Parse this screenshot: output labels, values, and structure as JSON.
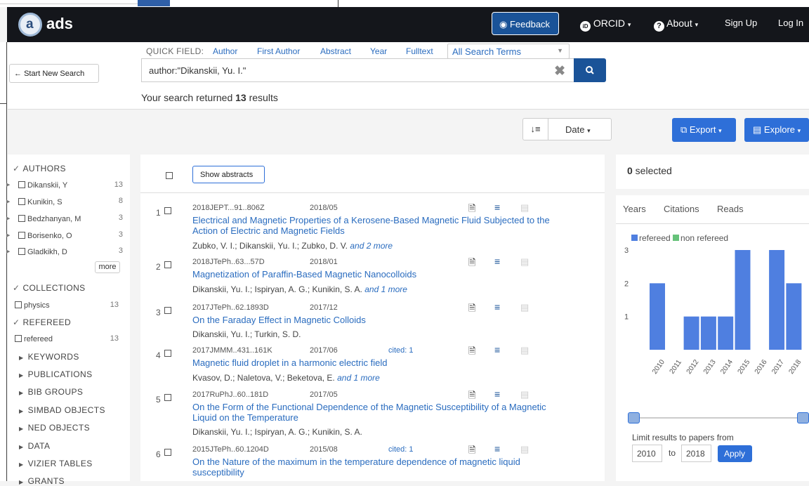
{
  "navbar": {
    "logo_letter": "a",
    "logo_text": "ads",
    "feedback": "Feedback",
    "orcid": "ORCID",
    "about": "About",
    "signup": "Sign Up",
    "login": "Log In"
  },
  "search": {
    "quick_field_label": "QUICK FIELD:",
    "quick_fields": [
      "Author",
      "First Author",
      "Abstract",
      "Year",
      "Fulltext"
    ],
    "select_value": "All Search Terms",
    "start_new": "Start New Search",
    "query": "author:\"Dikanskii, Yu. I.\"",
    "results_prefix": "Your search returned ",
    "results_count": "13",
    "results_suffix": " results"
  },
  "toolbar": {
    "sort_label": "Date",
    "export": "Export",
    "explore": "Explore"
  },
  "facets": {
    "authors_heading": "AUTHORS",
    "authors": [
      {
        "name": "Dikanskii, Y",
        "count": "13"
      },
      {
        "name": "Kunikin, S",
        "count": "8"
      },
      {
        "name": "Bedzhanyan, M",
        "count": "3"
      },
      {
        "name": "Borisenko, O",
        "count": "3"
      },
      {
        "name": "Gladkikh, D",
        "count": "3"
      }
    ],
    "more": "more",
    "collections_heading": "COLLECTIONS",
    "collections": [
      {
        "name": "physics",
        "count": "13"
      }
    ],
    "refereed_heading": "REFEREED",
    "refereed": [
      {
        "name": "refereed",
        "count": "13"
      }
    ],
    "other_headings": [
      "KEYWORDS",
      "PUBLICATIONS",
      "BIB GROUPS",
      "SIMBAD OBJECTS",
      "NED OBJECTS",
      "DATA",
      "VIZIER TABLES",
      "GRANTS"
    ]
  },
  "results": {
    "show_abstracts": "Show abstracts",
    "items": [
      {
        "num": "1",
        "bibcode": "2018JEPT...91..806Z",
        "date": "2018/05",
        "cited": "",
        "title": "Electrical and Magnetic Properties of a Kerosene-Based Magnetic Fluid Subjected to the Action of Electric and Magnetic Fields",
        "authors": "Zubko, V. I.;  Dikanskii, Yu. I.;  Zubko, D. V.",
        "more": "and 2 more"
      },
      {
        "num": "2",
        "bibcode": "2018JTePh..63...57D",
        "date": "2018/01",
        "cited": "",
        "title": "Magnetization of Paraffin-Based Magnetic Nanocolloids",
        "authors": "Dikanskii, Yu. I.;  Ispiryan, A. G.;  Kunikin, S. A.",
        "more": "and 1 more"
      },
      {
        "num": "3",
        "bibcode": "2017JTePh..62.1893D",
        "date": "2017/12",
        "cited": "",
        "title": "On the Faraday Effect in Magnetic Colloids",
        "authors": "Dikanskii, Yu. I.;  Turkin, S. D.",
        "more": ""
      },
      {
        "num": "4",
        "bibcode": "2017JMMM..431..161K",
        "date": "2017/06",
        "cited": "cited: 1",
        "title": "Magnetic fluid droplet in a harmonic electric field",
        "authors": "Kvasov, D.;  Naletova, V.;  Beketova, E.",
        "more": "and 1 more"
      },
      {
        "num": "5",
        "bibcode": "2017RuPhJ..60..181D",
        "date": "2017/05",
        "cited": "",
        "title": "On the Form of the Functional Dependence of the Magnetic Susceptibility of a Magnetic Liquid on the Temperature",
        "authors": "Dikanskii, Yu. I.;  Ispiryan, A. G.;  Kunikin, S. A.",
        "more": ""
      },
      {
        "num": "6",
        "bibcode": "2015JTePh..60.1204D",
        "date": "2015/08",
        "cited": "cited: 1",
        "title": "On the Nature of the maximum in the temperature dependence of magnetic liquid susceptibility",
        "authors": "",
        "more": ""
      }
    ]
  },
  "side": {
    "selected_count": "0",
    "selected_label": " selected",
    "tabs": [
      "Years",
      "Citations",
      "Reads"
    ],
    "legend_refereed": "refereed",
    "legend_nonrefereed": "non refereed",
    "colors": {
      "refereed": "#4f7fe0",
      "non_refereed": "#66c27a",
      "accent": "#2e6fd8"
    },
    "limit_label": "Limit results to papers from",
    "year_from": "2010",
    "to": "to",
    "year_to": "2018",
    "apply": "Apply"
  },
  "chart_data": {
    "type": "bar",
    "categories": [
      "2010",
      "2011",
      "2012",
      "2013",
      "2014",
      "2015",
      "2016",
      "2017",
      "2018"
    ],
    "series": [
      {
        "name": "refereed",
        "values": [
          2,
          0,
          1,
          1,
          1,
          3,
          0,
          3,
          2
        ]
      },
      {
        "name": "non refereed",
        "values": [
          0,
          0,
          0,
          0,
          0,
          0,
          0,
          0,
          0
        ]
      }
    ],
    "yticks": [
      "1",
      "2",
      "3"
    ],
    "ylim": [
      0,
      3
    ],
    "legend": "top-left"
  }
}
